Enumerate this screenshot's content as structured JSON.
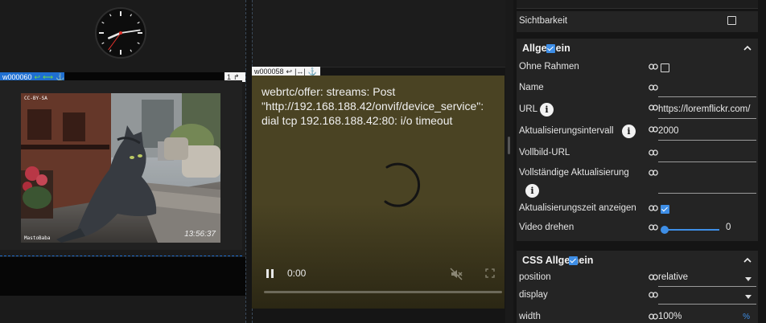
{
  "clock": {
    "hour": 8,
    "minute": 13,
    "second": 36
  },
  "tags": {
    "widget_left": "w000060",
    "widget_video": "w000058",
    "small_label": "1"
  },
  "camera": {
    "timestamp": "13:56:37",
    "watermark_top": "CC-BY-SA",
    "watermark_bottom": "MastoBaba"
  },
  "video": {
    "message": "webrtc/offer: streams: Post \"http://192.168.188.42/onvif/device_service\": dial tcp 192.168.188.42:80: i/o timeout",
    "time": "0:00",
    "progress": 0
  },
  "inspector": {
    "visibility_label": "Sichtbarkeit",
    "visibility_checked": false,
    "general": {
      "title": "Allgemein",
      "enabled": true,
      "no_frame_label": "Ohne Rahmen",
      "name_label": "Name",
      "name_value": "",
      "url_label": "URL",
      "url_value": "https://loremflickr.com/",
      "refresh_label": "Aktualisierungsintervall",
      "refresh_value": "2000",
      "fullscreen_url_label": "Vollbild-URL",
      "fullscreen_url_value": "",
      "full_refresh_label": "Vollständige Aktualisierung",
      "show_refresh_time_label": "Aktualisierungszeit anzeigen",
      "show_refresh_time_checked": true,
      "rotate_label": "Video drehen",
      "rotate_value": "0"
    },
    "css_general": {
      "title": "CSS Allgemein",
      "enabled": true,
      "position_label": "position",
      "position_value": "relative",
      "display_label": "display",
      "display_value": "",
      "width_label": "width",
      "width_value": "100%",
      "width_unit": "%"
    }
  },
  "colors": {
    "accent": "#3e8ee6",
    "tag_blue": "#1f6fd1",
    "video_bg": "#4a4323"
  }
}
